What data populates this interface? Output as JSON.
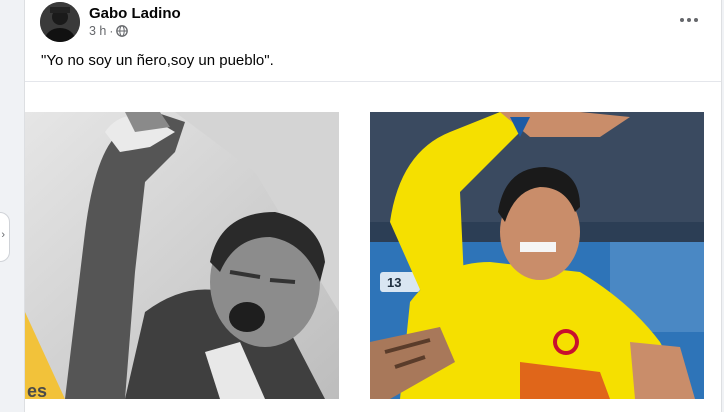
{
  "post": {
    "author": "Gabo Ladino",
    "time": "3 h",
    "separator": "·",
    "privacy_icon": "globe-icon",
    "text": "\"Yo no soy un ñero,soy un pueblo\".",
    "menu_icon": "more-options-icon",
    "left_photo_caption_fragment": "es"
  },
  "colors": {
    "page_background": "#f0f2f5",
    "card_background": "#ffffff",
    "secondary_text": "#65676b",
    "primary_text": "#050505",
    "jersey_yellow": "#f5e000",
    "stadium_blue": "#2e74b8"
  }
}
